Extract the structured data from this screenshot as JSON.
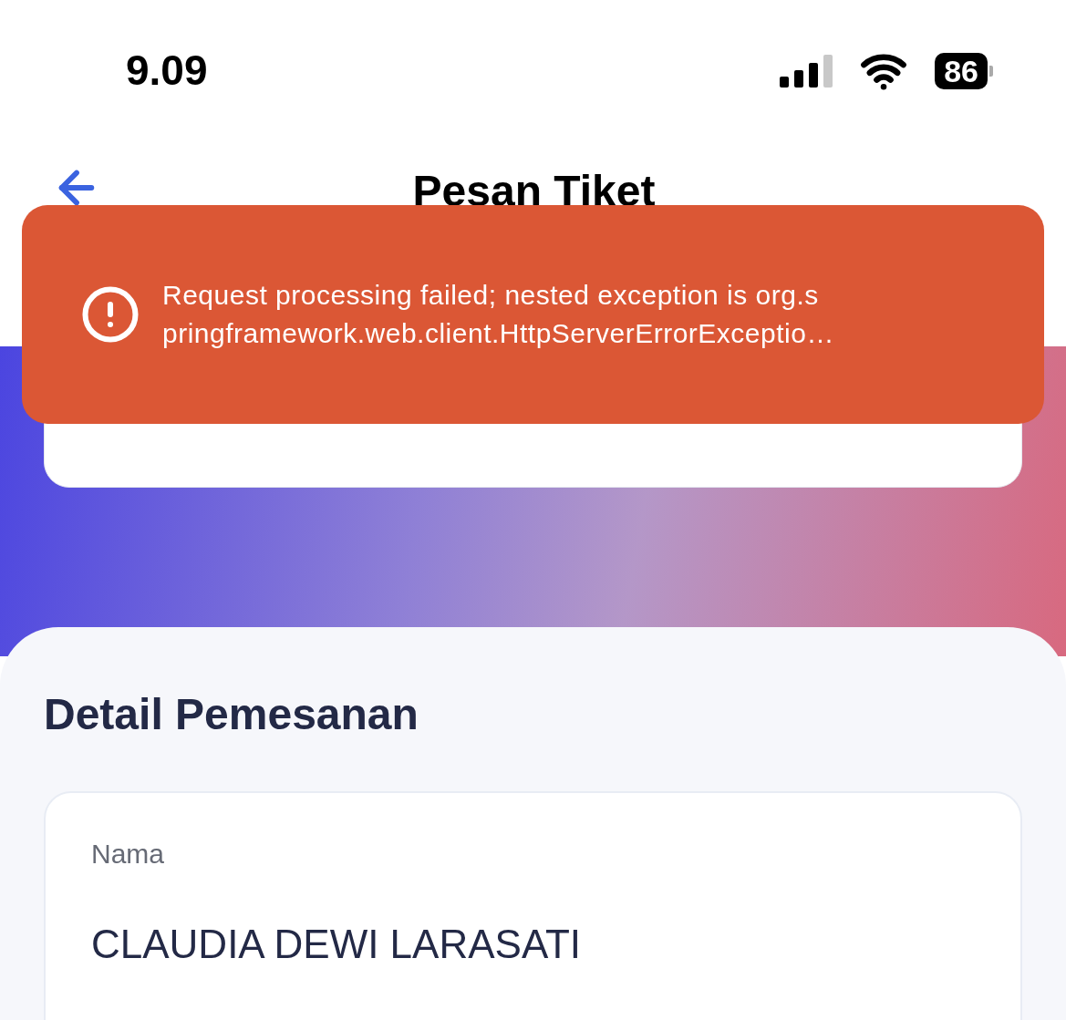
{
  "status_bar": {
    "time": "9.09",
    "battery": "86"
  },
  "header": {
    "title": "Pesan Tiket"
  },
  "toast": {
    "message_lines": [
      "Request processing failed; nested exception is org.s",
      "pringframework.web.client.HttpServerErrorExceptio…"
    ]
  },
  "section": {
    "title": "Detail Pemesanan"
  },
  "detail_card": {
    "label": "Nama",
    "value": "CLAUDIA DEWI LARASATI"
  }
}
